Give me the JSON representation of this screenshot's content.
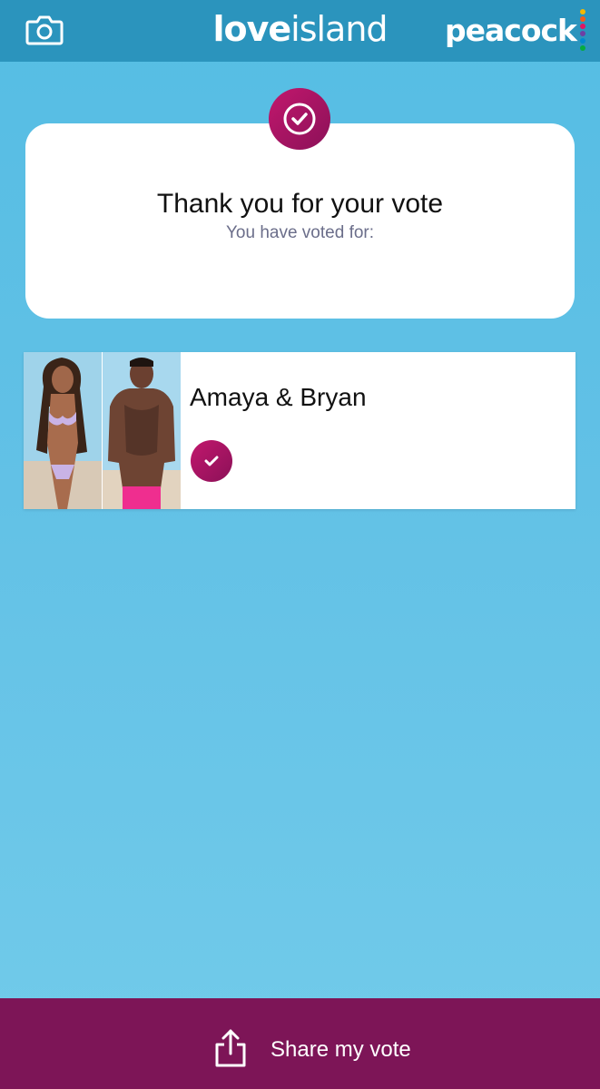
{
  "header": {
    "camera_icon": "camera-icon",
    "logo_bold": "love",
    "logo_light": "island",
    "brand": "peacock",
    "brand_dot_colors": [
      "#f5b800",
      "#f25c19",
      "#e01563",
      "#6e3fa3",
      "#0089cf",
      "#05ac3f"
    ]
  },
  "confirmation": {
    "icon": "checkmark-icon",
    "title": "Thank you for your vote",
    "subtitle": "You have voted for:"
  },
  "couple": {
    "name": "Amaya & Bryan",
    "selected": true,
    "photos": [
      "contestant-photo",
      "contestant-photo"
    ]
  },
  "footer": {
    "share_icon": "share-icon",
    "share_label": "Share my vote"
  },
  "colors": {
    "header_bg": "#2b94bd",
    "accent": "#c2176d",
    "footer_bg": "#7d1557",
    "page_bg": "#5ec0e5"
  }
}
